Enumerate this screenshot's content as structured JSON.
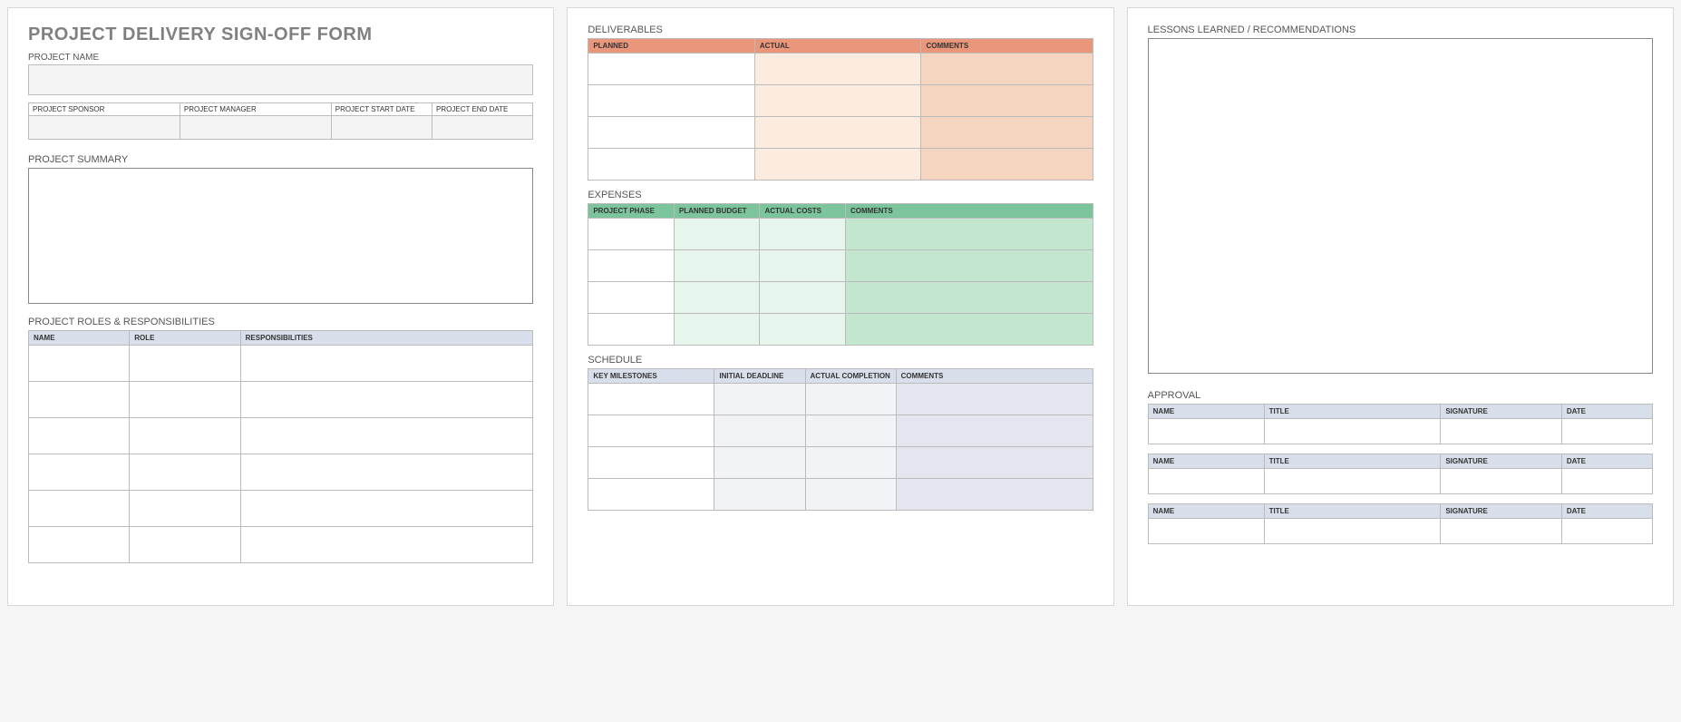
{
  "form": {
    "title": "PROJECT DELIVERY SIGN-OFF FORM",
    "project_name_label": "PROJECT NAME",
    "info_headers": [
      "PROJECT SPONSOR",
      "PROJECT MANAGER",
      "PROJECT START DATE",
      "PROJECT END DATE"
    ],
    "summary_label": "PROJECT SUMMARY",
    "roles_label": "PROJECT ROLES & RESPONSIBILITIES",
    "roles_headers": [
      "NAME",
      "ROLE",
      "RESPONSIBILITIES"
    ]
  },
  "deliverables": {
    "label": "DELIVERABLES",
    "headers": [
      "PLANNED",
      "ACTUAL",
      "COMMENTS"
    ]
  },
  "expenses": {
    "label": "EXPENSES",
    "headers": [
      "PROJECT PHASE",
      "PLANNED BUDGET",
      "ACTUAL COSTS",
      "COMMENTS"
    ]
  },
  "schedule": {
    "label": "SCHEDULE",
    "headers": [
      "KEY MILESTONES",
      "INITIAL DEADLINE",
      "ACTUAL COMPLETION",
      "COMMENTS"
    ]
  },
  "lessons": {
    "label": "LESSONS LEARNED / RECOMMENDATIONS"
  },
  "approval": {
    "label": "APPROVAL",
    "headers": [
      "NAME",
      "TITLE",
      "SIGNATURE",
      "DATE"
    ]
  }
}
